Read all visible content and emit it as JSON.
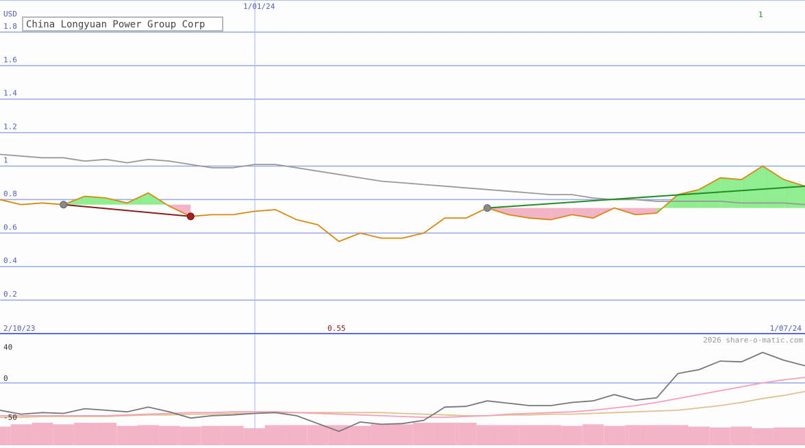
{
  "chart_data": [
    {
      "type": "line",
      "title": "China Longyuan Power Group Corp",
      "currency_label": "USD",
      "date_label": "1/01/24",
      "start_date_label": "2/10/23",
      "end_date_label": "1/07/24",
      "mid_label": "0.55",
      "corner_label": "1",
      "ylim": [
        0,
        1.8
      ],
      "yticks": [
        0.2,
        0.4,
        0.6,
        0.8,
        1,
        1.2,
        1.4,
        1.6,
        1.8
      ],
      "grid": true,
      "series": [
        {
          "role": "price",
          "color": "#d48a10",
          "values": [
            0.8,
            0.77,
            0.78,
            0.77,
            0.82,
            0.81,
            0.78,
            0.84,
            0.76,
            0.7,
            0.71,
            0.71,
            0.73,
            0.74,
            0.68,
            0.65,
            0.55,
            0.6,
            0.57,
            0.57,
            0.6,
            0.69,
            0.69,
            0.75,
            0.71,
            0.69,
            0.68,
            0.71,
            0.69,
            0.75,
            0.71,
            0.72,
            0.83,
            0.86,
            0.93,
            0.92,
            1.0,
            0.92,
            0.88
          ]
        },
        {
          "role": "moving-average",
          "color": "#999999",
          "values": [
            1.07,
            1.06,
            1.05,
            1.05,
            1.03,
            1.04,
            1.02,
            1.04,
            1.03,
            1.01,
            0.99,
            0.99,
            1.01,
            1.01,
            0.99,
            0.97,
            0.95,
            0.93,
            0.91,
            0.9,
            0.89,
            0.88,
            0.87,
            0.86,
            0.85,
            0.84,
            0.83,
            0.83,
            0.81,
            0.8,
            0.8,
            0.79,
            0.79,
            0.79,
            0.79,
            0.78,
            0.78,
            0.78,
            0.77
          ]
        }
      ],
      "trades": [
        {
          "start_index": 3,
          "end_index": 9,
          "start_value": 0.77,
          "end_value": 0.7,
          "result": "loss",
          "color": "#8b1a1a"
        },
        {
          "start_index": 23,
          "end_index": 38,
          "start_value": 0.75,
          "end_value": 0.88,
          "result": "gain",
          "color": "#228b22"
        }
      ],
      "colors": {
        "gain_fill": "#90ee90",
        "loss_fill": "#f4b4c8",
        "grid": "#9aa7e8",
        "axis_text": "#5560b0"
      }
    },
    {
      "type": "line",
      "credit": "2026 share-o-matic.com",
      "ylim": [
        -50,
        40
      ],
      "yticks": [
        40,
        0,
        -50
      ],
      "series": [
        {
          "role": "oscillator",
          "color": "#777777",
          "values": [
            -35,
            -40,
            -38,
            -39,
            -33,
            -35,
            -37,
            -31,
            -37,
            -45,
            -42,
            -41,
            -39,
            -38,
            -42,
            -52,
            -62,
            -50,
            -53,
            -52,
            -48,
            -31,
            -30,
            -23,
            -26,
            -29,
            -29,
            -25,
            -23,
            -15,
            -22,
            -19,
            12,
            17,
            28,
            27,
            39,
            29,
            22
          ]
        },
        {
          "role": "signal-pink",
          "color": "#f4a0b8",
          "values": [
            -42,
            -42,
            -42,
            -42,
            -42,
            -42,
            -41,
            -40,
            -39,
            -38,
            -38,
            -37,
            -37,
            -37,
            -38,
            -39,
            -40,
            -41,
            -42,
            -43,
            -44,
            -44,
            -43,
            -42,
            -40,
            -39,
            -38,
            -37,
            -35,
            -32,
            -29,
            -25,
            -20,
            -15,
            -10,
            -5,
            0,
            4,
            7
          ]
        },
        {
          "role": "signal-tan",
          "color": "#e0c090",
          "values": [
            -44,
            -44,
            -43,
            -43,
            -43,
            -43,
            -42,
            -41,
            -41,
            -40,
            -40,
            -39,
            -39,
            -38,
            -38,
            -38,
            -38,
            -38,
            -38,
            -39,
            -40,
            -41,
            -42,
            -42,
            -41,
            -41,
            -40,
            -40,
            -39,
            -38,
            -37,
            -36,
            -35,
            -32,
            -29,
            -25,
            -20,
            -16,
            -11
          ]
        },
        {
          "role": "histogram",
          "color": "#f4b4c8",
          "values": [
            -56,
            -53,
            -51,
            -53,
            -51,
            -51,
            -55,
            -54,
            -55,
            -56,
            -55,
            -55,
            -58,
            -54,
            -54,
            -54,
            -54,
            -55,
            -53,
            -53,
            -51,
            -51,
            -51,
            -54,
            -54,
            -54,
            -54,
            -55,
            -53,
            -55,
            -54,
            -54,
            -54,
            -56,
            -57,
            -56,
            -58,
            -57,
            -57
          ]
        }
      ]
    }
  ]
}
